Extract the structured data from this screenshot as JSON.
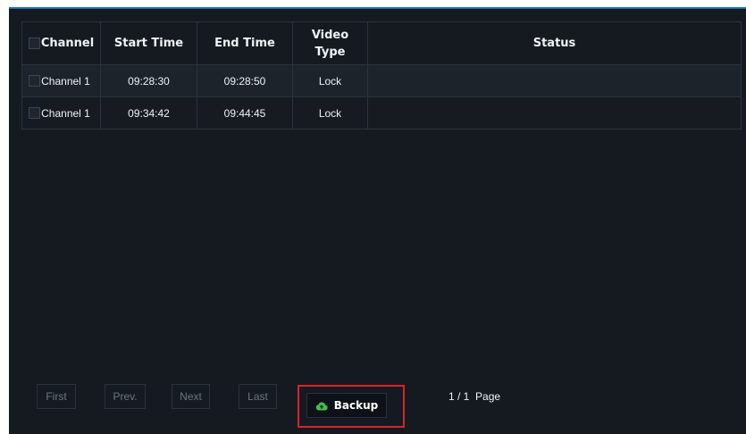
{
  "table": {
    "headers": {
      "channel": "Channel",
      "start_time": "Start Time",
      "end_time": "End Time",
      "video_type": "Video Type",
      "status": "Status"
    },
    "rows": [
      {
        "channel": "Channel 1",
        "start_time": "09:28:30",
        "end_time": "09:28:50",
        "video_type": "Lock",
        "status": ""
      },
      {
        "channel": "Channel 1",
        "start_time": "09:34:42",
        "end_time": "09:44:45",
        "video_type": "Lock",
        "status": ""
      }
    ]
  },
  "pagination": {
    "first_label": "First",
    "prev_label": "Prev.",
    "next_label": "Next",
    "last_label": "Last",
    "page_info": "1 / 1  Page"
  },
  "backup": {
    "label": "Backup",
    "icon": "cloud-upload-icon",
    "icon_color": "#3fbf4f"
  },
  "colors": {
    "background": "#151a21",
    "accent": "#1d6fb8",
    "highlight": "#d8232a"
  }
}
